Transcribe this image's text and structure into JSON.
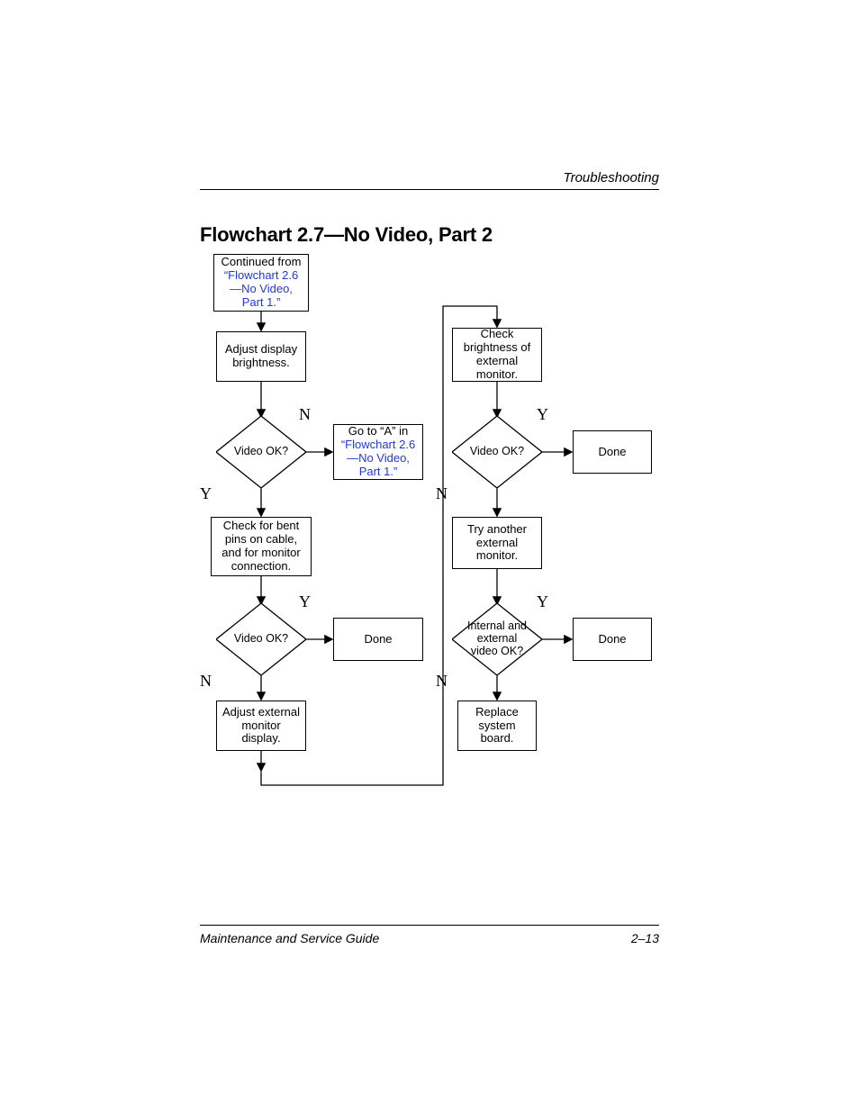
{
  "header": {
    "section": "Troubleshooting"
  },
  "title": "Flowchart 2.7—No Video, Part 2",
  "footer": {
    "left": "Maintenance and Service Guide",
    "right": "2–13"
  },
  "nodes": {
    "continued_prefix": "Continued from",
    "continued_link": "“Flowchart 2.6—No Video, Part 1.”",
    "adjust_display": "Adjust display brightness.",
    "video_ok": "Video OK?",
    "goto_a_prefix": "Go to “A” in",
    "goto_a_link": "“Flowchart 2.6—No Video, Part 1.”",
    "check_bent_pins": "Check for bent pins on cable, and for monitor connection.",
    "done": "Done",
    "adjust_external": "Adjust external monitor display.",
    "check_brightness_ext": "Check brightness of external monitor.",
    "try_another": "Try another external monitor.",
    "int_ext_ok": "Internal and external video OK?",
    "replace_board": "Replace system board."
  },
  "branch": {
    "Y": "Y",
    "N": "N"
  }
}
